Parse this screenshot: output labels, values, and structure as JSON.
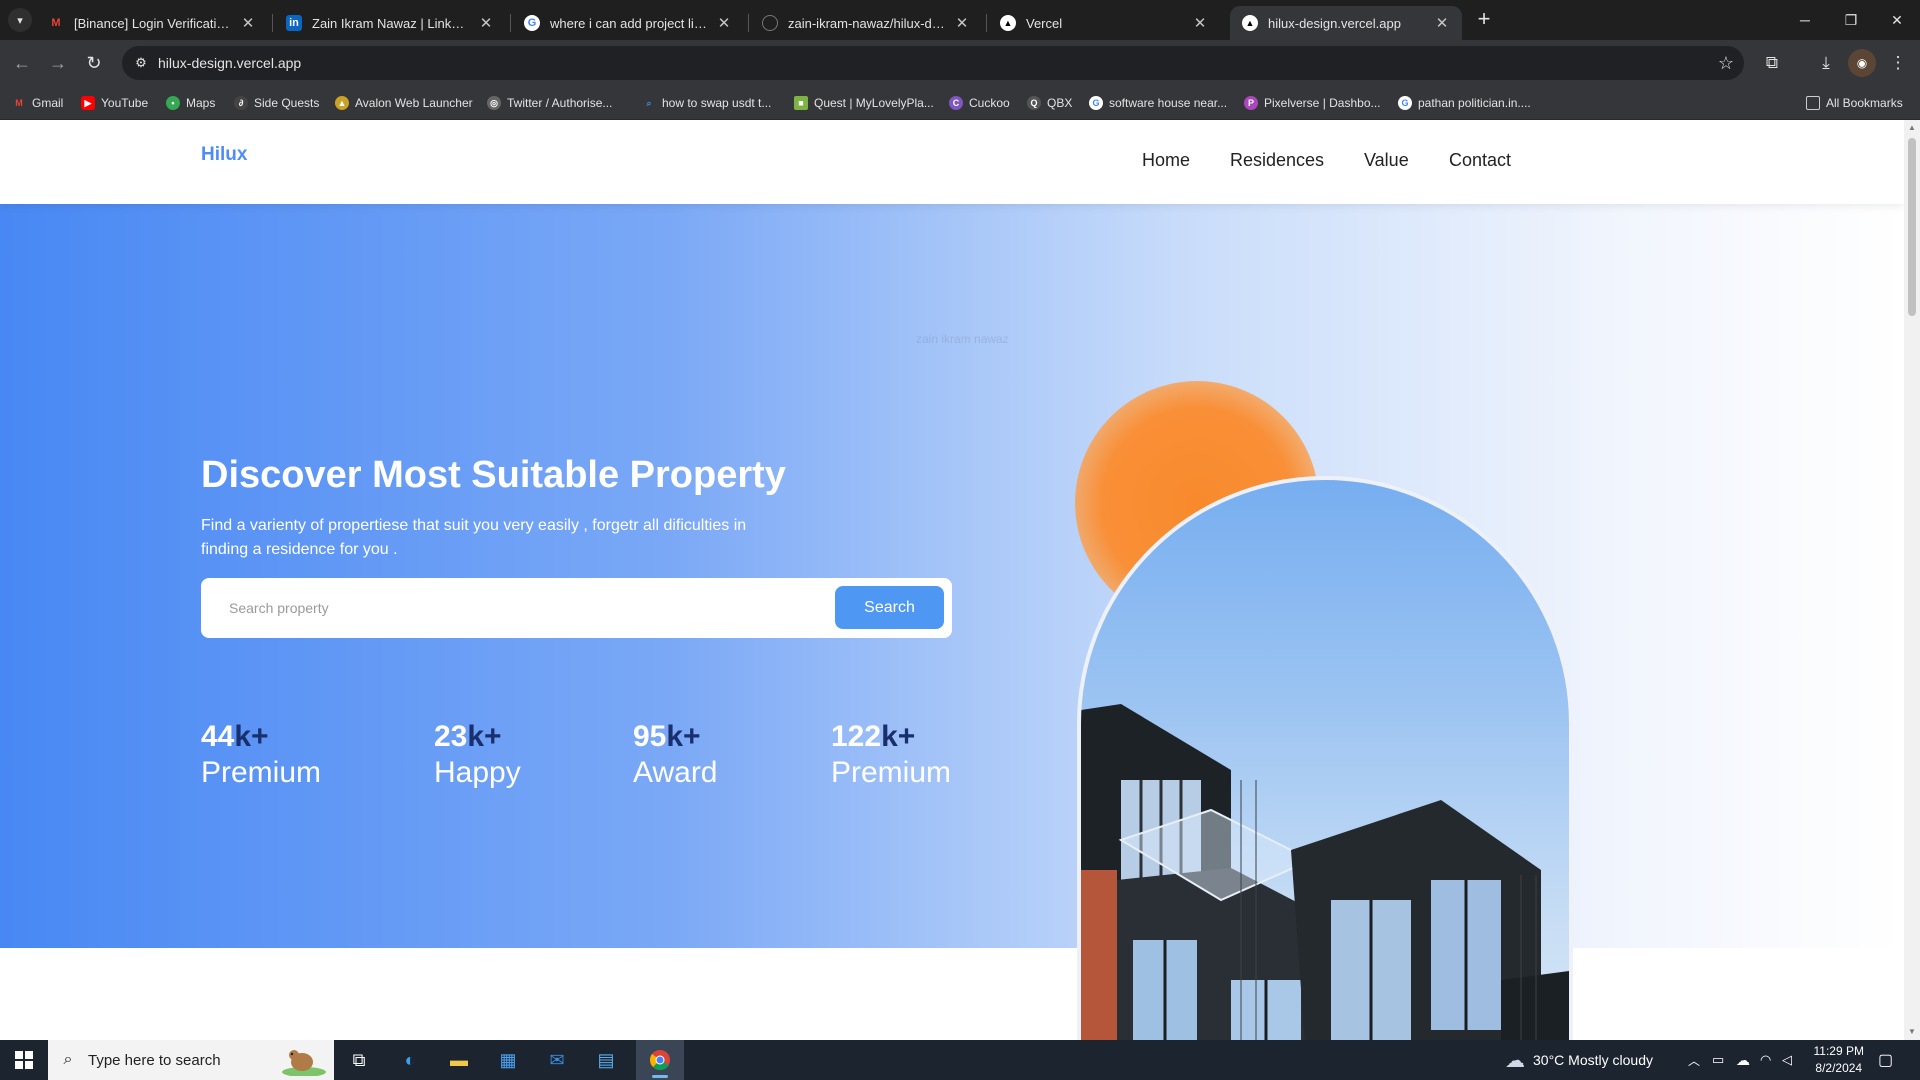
{
  "browser": {
    "tabs": [
      {
        "title": "[Binance] Login Verification - 20",
        "icon": "gmail-icon"
      },
      {
        "title": "Zain Ikram Nawaz | LinkedIn",
        "icon": "linkedin-icon"
      },
      {
        "title": "where i can add project linkedin",
        "icon": "google-icon"
      },
      {
        "title": "zain-ikram-nawaz/hilux-design",
        "icon": "github-icon"
      },
      {
        "title": "Vercel",
        "icon": "vercel-icon"
      },
      {
        "title": "hilux-design.vercel.app",
        "icon": "vercel-icon"
      }
    ],
    "active_tab_index": 5,
    "url": "hilux-design.vercel.app",
    "bookmarks": [
      {
        "label": "Gmail",
        "icon": "gmail-icon"
      },
      {
        "label": "YouTube",
        "icon": "youtube-icon"
      },
      {
        "label": "Maps",
        "icon": "maps-icon"
      },
      {
        "label": "Side Quests",
        "icon": "quests-icon"
      },
      {
        "label": "Avalon Web Launcher",
        "icon": "avalon-icon"
      },
      {
        "label": "Twitter / Authorise...",
        "icon": "globe-icon"
      },
      {
        "label": "how to swap usdt t...",
        "icon": "search-icon"
      },
      {
        "label": "Quest | MyLovelyPla...",
        "icon": "quest-icon"
      },
      {
        "label": "Cuckoo",
        "icon": "cuckoo-icon"
      },
      {
        "label": "QBX",
        "icon": "qbx-icon"
      },
      {
        "label": "software house near...",
        "icon": "google-icon"
      },
      {
        "label": "Pixelverse | Dashbo...",
        "icon": "pixelverse-icon"
      },
      {
        "label": "pathan politician.in....",
        "icon": "google-icon"
      }
    ],
    "all_bookmarks_label": "All Bookmarks"
  },
  "site": {
    "logo": "Hilux",
    "nav": [
      "Home",
      "Residences",
      "Value",
      "Contact"
    ],
    "hero": {
      "made_by": "zain ikram nawaz",
      "title": "Discover Most Suitable Property",
      "subtitle": "Find a varienty of propertiese that suit you very easily , forgetr all dificulties in finding a residence for you .",
      "search_placeholder": "Search property",
      "search_button": "Search",
      "stats": [
        {
          "number": "44",
          "suffix": "k+",
          "label": "Premium"
        },
        {
          "number": "23",
          "suffix": "k+",
          "label": "Happy"
        },
        {
          "number": "95",
          "suffix": "k+",
          "label": "Award"
        },
        {
          "number": "122",
          "suffix": "k+",
          "label": "Premium"
        }
      ]
    }
  },
  "taskbar": {
    "search_placeholder": "Type here to search",
    "weather": "30°C  Mostly cloudy",
    "time": "11:29 PM",
    "date": "8/2/2024"
  },
  "colors": {
    "accent": "#4f8df5",
    "hero_start": "#4888f4",
    "search_button": "#4e97f3",
    "sun": "#f88a2c",
    "stat_suffix": "#1a2f6e"
  }
}
